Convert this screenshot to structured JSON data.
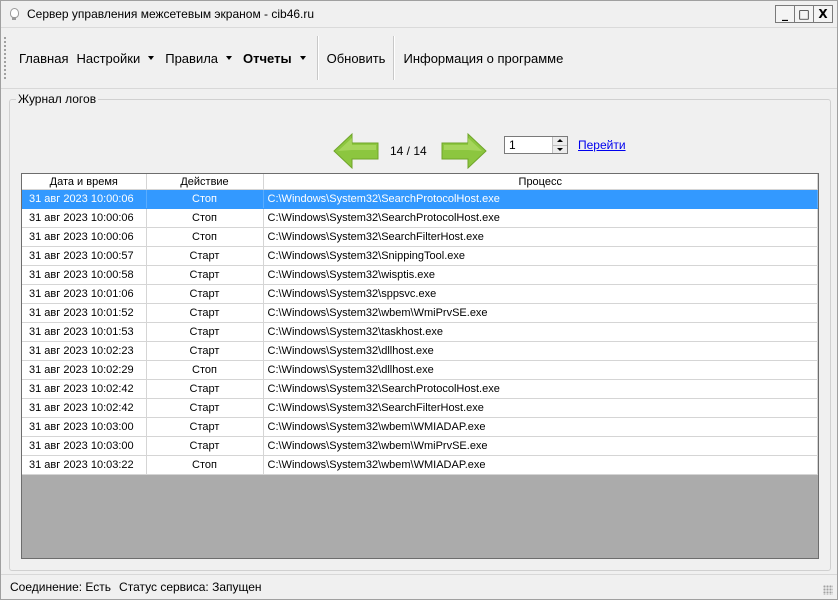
{
  "window": {
    "title": "Сервер управления межсетевым экраном - cib46.ru",
    "controls": {
      "minimize": "_",
      "maximize": "□",
      "close": "X"
    }
  },
  "menu": {
    "items": [
      {
        "label": "Главная",
        "bold": false,
        "dropdown": false
      },
      {
        "label": "Настройки",
        "bold": false,
        "dropdown": true
      },
      {
        "label": "Правила",
        "bold": false,
        "dropdown": true
      },
      {
        "label": "Отчеты",
        "bold": true,
        "dropdown": true
      },
      {
        "label": "Обновить",
        "bold": false,
        "dropdown": false
      },
      {
        "label": "Информация о программе",
        "bold": false,
        "dropdown": false
      }
    ]
  },
  "log": {
    "group_label": "Журнал логов",
    "pager": {
      "page_label": "14 / 14",
      "page_input": "1",
      "goto_label": "Перейти"
    },
    "columns": [
      "Дата и время",
      "Действие",
      "Процесс"
    ],
    "rows": [
      {
        "datetime": "31 авг 2023 10:00:06",
        "action": "Стоп",
        "process": "C:\\Windows\\System32\\SearchProtocolHost.exe"
      },
      {
        "datetime": "31 авг 2023 10:00:06",
        "action": "Стоп",
        "process": "C:\\Windows\\System32\\SearchProtocolHost.exe"
      },
      {
        "datetime": "31 авг 2023 10:00:06",
        "action": "Стоп",
        "process": "C:\\Windows\\System32\\SearchFilterHost.exe"
      },
      {
        "datetime": "31 авг 2023 10:00:57",
        "action": "Старт",
        "process": "C:\\Windows\\System32\\SnippingTool.exe"
      },
      {
        "datetime": "31 авг 2023 10:00:58",
        "action": "Старт",
        "process": "C:\\Windows\\System32\\wisptis.exe"
      },
      {
        "datetime": "31 авг 2023 10:01:06",
        "action": "Старт",
        "process": "C:\\Windows\\System32\\sppsvc.exe"
      },
      {
        "datetime": "31 авг 2023 10:01:52",
        "action": "Старт",
        "process": "C:\\Windows\\System32\\wbem\\WmiPrvSE.exe"
      },
      {
        "datetime": "31 авг 2023 10:01:53",
        "action": "Старт",
        "process": "C:\\Windows\\System32\\taskhost.exe"
      },
      {
        "datetime": "31 авг 2023 10:02:23",
        "action": "Старт",
        "process": "C:\\Windows\\System32\\dllhost.exe"
      },
      {
        "datetime": "31 авг 2023 10:02:29",
        "action": "Стоп",
        "process": "C:\\Windows\\System32\\dllhost.exe"
      },
      {
        "datetime": "31 авг 2023 10:02:42",
        "action": "Старт",
        "process": "C:\\Windows\\System32\\SearchProtocolHost.exe"
      },
      {
        "datetime": "31 авг 2023 10:02:42",
        "action": "Старт",
        "process": "C:\\Windows\\System32\\SearchFilterHost.exe"
      },
      {
        "datetime": "31 авг 2023 10:03:00",
        "action": "Старт",
        "process": "C:\\Windows\\System32\\wbem\\WMIADAP.exe"
      },
      {
        "datetime": "31 авг 2023 10:03:00",
        "action": "Старт",
        "process": "C:\\Windows\\System32\\wbem\\WmiPrvSE.exe"
      },
      {
        "datetime": "31 авг 2023 10:03:22",
        "action": "Стоп",
        "process": "C:\\Windows\\System32\\wbem\\WMIADAP.exe"
      }
    ],
    "selected_row": 0
  },
  "status": {
    "connection": "Соединение: Есть",
    "service": "Статус сервиса: Запущен"
  },
  "colors": {
    "selection": "#3399ff",
    "arrow_green": "#8cc63f",
    "grid_empty": "#ababab",
    "link": "#0000ee"
  },
  "icons": {
    "app": "lightbulb-icon",
    "prev": "arrow-left-icon",
    "next": "arrow-right-icon"
  }
}
